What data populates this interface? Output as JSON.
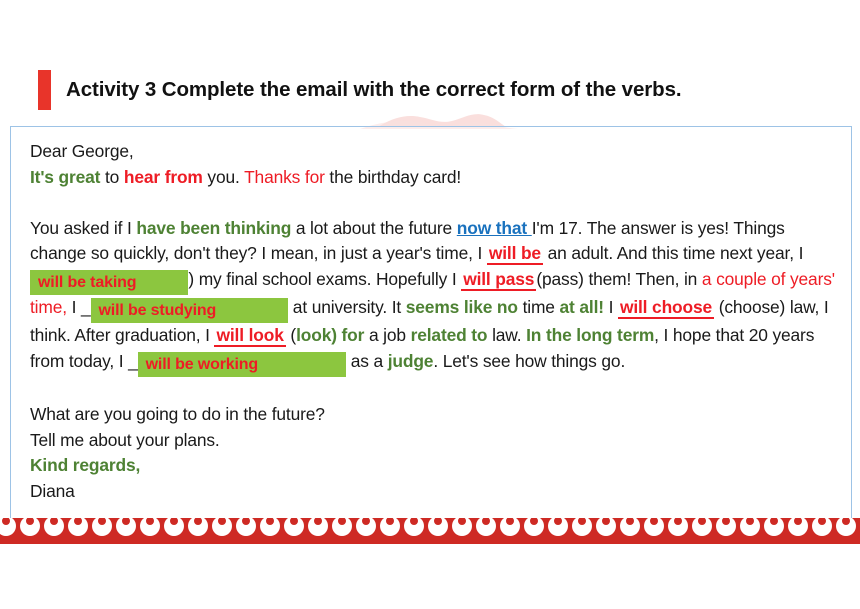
{
  "slide": {
    "title": "Activity 3 Complete the email with the correct form of the verbs.",
    "accent_red": "#E8342A",
    "highlight_green": "#8CC63F",
    "answer_red": "#EE1C25",
    "phrase_green": "#4E8234",
    "link_blue": "#1A72BE",
    "box_border_blue": "#9DC3E6"
  },
  "email": {
    "greeting": "Dear George,",
    "line2": {
      "a_green": "It's great",
      "b_plain": " to ",
      "c_red_bold": "hear from",
      "d_plain": " you. ",
      "e_red": "Thanks for",
      "f_plain": " the birthday card!"
    },
    "para2": {
      "s1": "You asked if I ",
      "s2_green": "have been thinking",
      "s3": " a lot about the future ",
      "s4_blue_underline": "now that ",
      "s5": "I'm 17. The answer is yes! Things change so quickly, don't they? I mean, in just a year's time, I ",
      "s6_answer": "will be",
      "s7": " an adult. And this time next year, I ",
      "s8_highlight": "will be taking",
      "s9": ") my final school exams. Hopefully I ",
      "s10_answer": "will pass",
      "s11": "(pass) them! Then, in ",
      "s12_red": "a couple of years' time,",
      "s13": " I _",
      "s14_highlight": "will be studying",
      "s15": " at university. It ",
      "s16_green": "seems like no",
      "s17": " time ",
      "s18_green": "at all!",
      "s19": " I ",
      "s20_answer": "will choose",
      "s21": " (choose) law, I think. After graduation, I ",
      "s22_answer": "will look",
      "s23": " (",
      "s24_green": "look) for",
      "s25": " a job ",
      "s26_green": "related to",
      "s27": " law. ",
      "s28_green": "In the long term",
      "s29": ", I hope that 20 years from today, I _",
      "s30_highlight": "will be working",
      "s31": " as a ",
      "s32_green": "judge",
      "s33": ". Let's see how things go."
    },
    "question": "What are you going to do in the future?",
    "request": "Tell me about your plans.",
    "closing_green": "Kind regards,",
    "signature": "Diana"
  }
}
